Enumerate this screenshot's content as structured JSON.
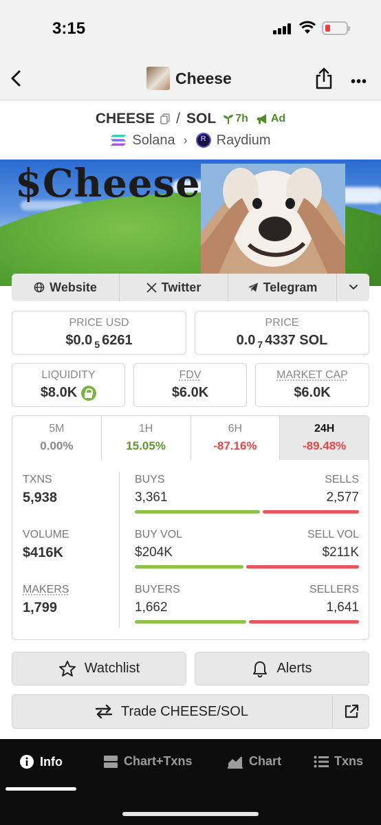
{
  "status_bar": {
    "time": "3:15"
  },
  "nav": {
    "title": "Cheese",
    "more": "•••"
  },
  "pair": {
    "base": "CHEESE",
    "separator": "/",
    "quote": "SOL",
    "age": "7h",
    "ad": "Ad",
    "chain": "Solana",
    "dex": "Raydium"
  },
  "banner": {
    "title": "$Cheese"
  },
  "social": {
    "website": "Website",
    "twitter": "Twitter",
    "telegram": "Telegram"
  },
  "prices": {
    "price_usd_label": "PRICE USD",
    "price_usd_prefix": "$0.0",
    "price_usd_sub": "5",
    "price_usd_digits": "6261",
    "price_label": "PRICE",
    "price_prefix": "0.0",
    "price_sub": "7",
    "price_digits": "4337 SOL"
  },
  "metrics": {
    "liquidity_label": "LIQUIDITY",
    "liquidity_value": "$8.0K",
    "fdv_label": "FDV",
    "fdv_value": "$6.0K",
    "mcap_label": "MARKET CAP",
    "mcap_value": "$6.0K"
  },
  "timeframes": [
    {
      "label": "5M",
      "value": "0.00%",
      "color": "#888888"
    },
    {
      "label": "1H",
      "value": "15.05%",
      "color": "#5a9a2c"
    },
    {
      "label": "6H",
      "value": "-87.16%",
      "color": "#e04848"
    },
    {
      "label": "24H",
      "value": "-89.48%",
      "color": "#e04848"
    }
  ],
  "stats": {
    "txns_label": "TXNS",
    "txns_value": "5,938",
    "volume_label": "VOLUME",
    "volume_value": "$416K",
    "makers_label": "MAKERS",
    "makers_value": "1,799",
    "buys_label": "BUYS",
    "buys_value": "3,361",
    "sells_label": "SELLS",
    "sells_value": "2,577",
    "buy_vol_label": "BUY VOL",
    "buy_vol_value": "$204K",
    "sell_vol_label": "SELL VOL",
    "sell_vol_value": "$211K",
    "buyers_label": "BUYERS",
    "buyers_value": "1,662",
    "sellers_label": "SELLERS",
    "sellers_value": "1,641",
    "buys_fraction": 0.566,
    "buy_vol_fraction": 0.49,
    "buyers_fraction": 0.503
  },
  "actions": {
    "watchlist": "Watchlist",
    "alerts": "Alerts",
    "trade": "Trade CHEESE/SOL"
  },
  "tabs": {
    "info": "Info",
    "chart_txns": "Chart+Txns",
    "chart": "Chart",
    "txns": "Txns"
  },
  "colors": {
    "green": "#8dc24f",
    "red": "#e85a5a",
    "tab_bg": "#0d0d0d"
  }
}
